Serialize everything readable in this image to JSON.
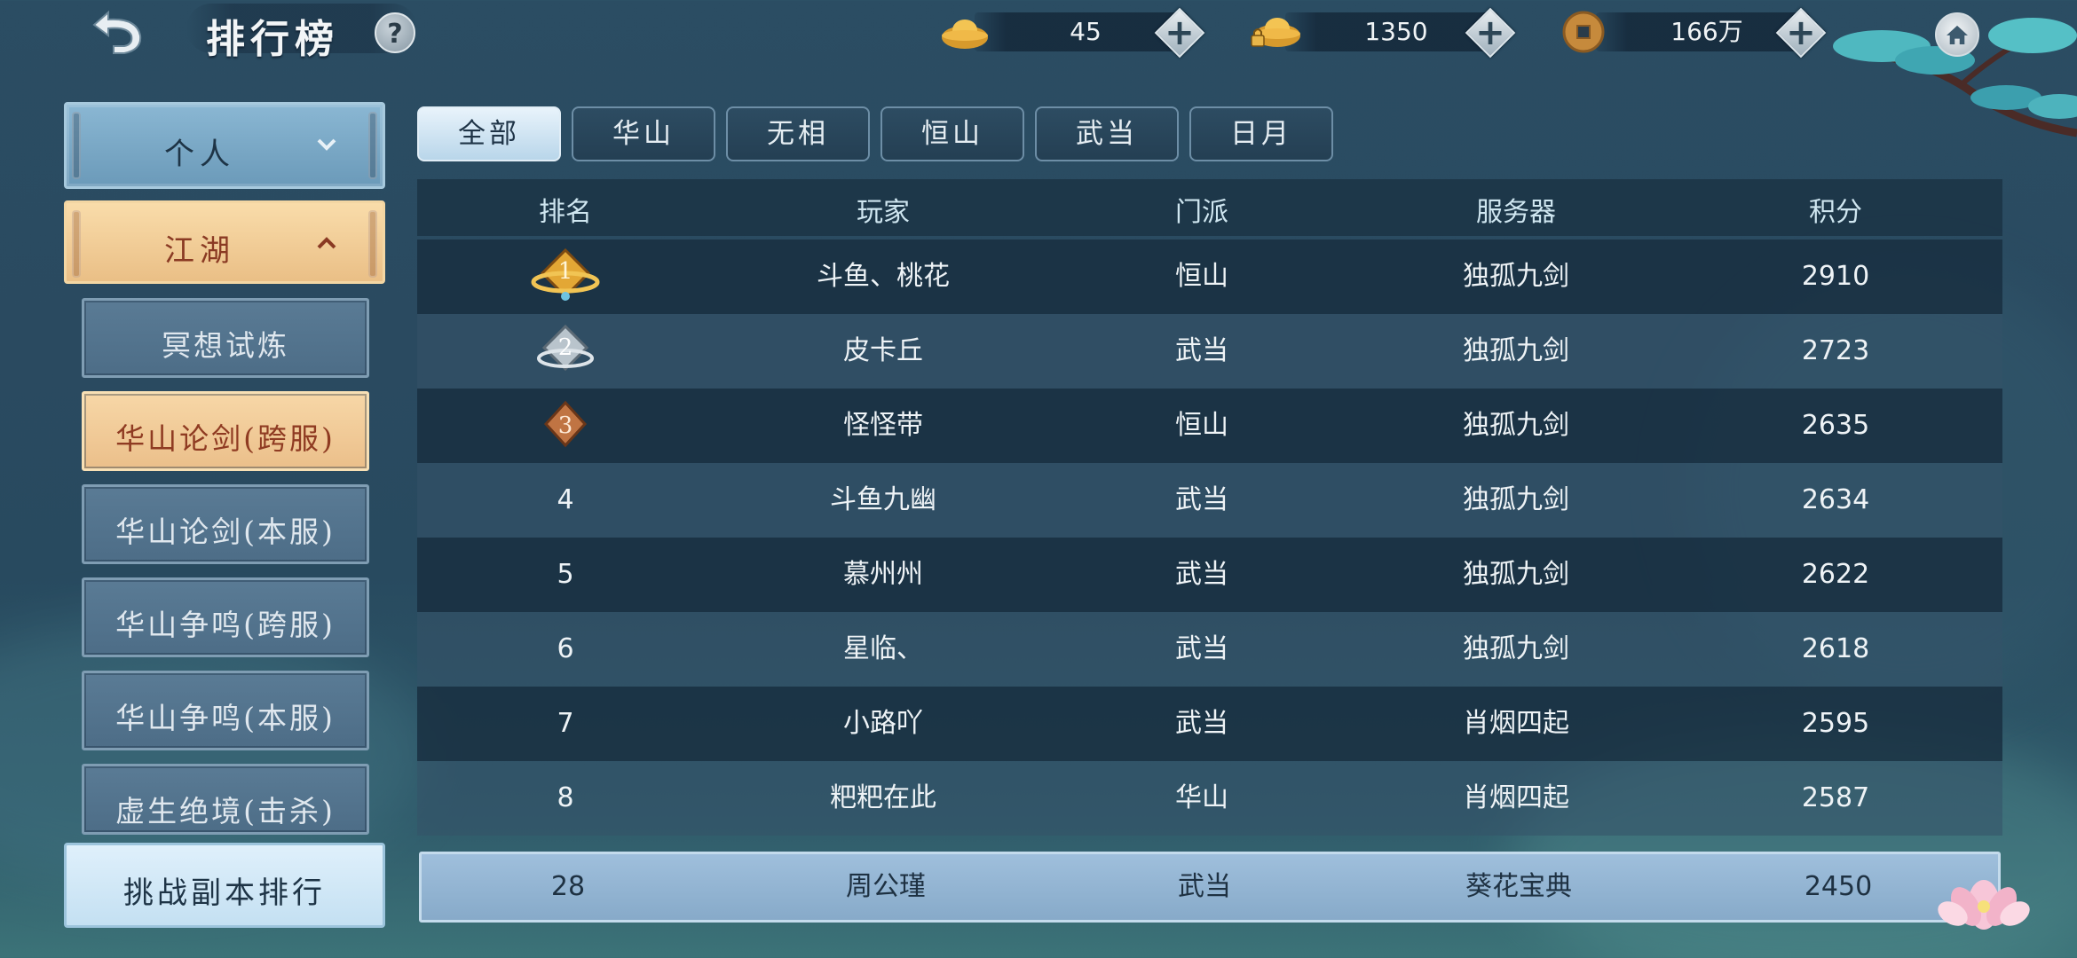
{
  "header": {
    "title": "排行榜",
    "help_label": "?",
    "currencies": [
      {
        "icon": "gold-ingot-icon",
        "value": "45"
      },
      {
        "icon": "locked-ingot-icon",
        "value": "1350"
      },
      {
        "icon": "copper-coin-icon",
        "value": "166万"
      }
    ],
    "plus_label": "+"
  },
  "sidebar": {
    "top_category": "个人",
    "active_category": "江湖",
    "items": [
      {
        "label": "冥想试炼",
        "active": false
      },
      {
        "label": "华山论剑(跨服)",
        "active": true
      },
      {
        "label": "华山论剑(本服)",
        "active": false
      },
      {
        "label": "华山争鸣(跨服)",
        "active": false
      },
      {
        "label": "华山争鸣(本服)",
        "active": false
      },
      {
        "label": "虚生绝境(击杀)",
        "active": false
      }
    ],
    "bottom_item": "挑战副本排行"
  },
  "tabs": [
    {
      "label": "全部",
      "active": true
    },
    {
      "label": "华山",
      "active": false
    },
    {
      "label": "无相",
      "active": false
    },
    {
      "label": "恒山",
      "active": false
    },
    {
      "label": "武当",
      "active": false
    },
    {
      "label": "日月",
      "active": false
    }
  ],
  "table": {
    "columns": [
      "排名",
      "玩家",
      "门派",
      "服务器",
      "积分"
    ],
    "rows": [
      {
        "rank": "1",
        "medal": "gold-medal-icon",
        "player": "斗鱼、桃花",
        "sect": "恒山",
        "server": "独孤九剑",
        "score": "2910"
      },
      {
        "rank": "2",
        "medal": "silver-medal-icon",
        "player": "皮卡丘",
        "sect": "武当",
        "server": "独孤九剑",
        "score": "2723"
      },
      {
        "rank": "3",
        "medal": "bronze-medal-icon",
        "player": "怪怪带",
        "sect": "恒山",
        "server": "独孤九剑",
        "score": "2635"
      },
      {
        "rank": "4",
        "player": "斗鱼九幽",
        "sect": "武当",
        "server": "独孤九剑",
        "score": "2634"
      },
      {
        "rank": "5",
        "player": "慕州州",
        "sect": "武当",
        "server": "独孤九剑",
        "score": "2622"
      },
      {
        "rank": "6",
        "player": "星临、",
        "sect": "武当",
        "server": "独孤九剑",
        "score": "2618"
      },
      {
        "rank": "7",
        "player": "小路吖",
        "sect": "武当",
        "server": "肖烟四起",
        "score": "2595"
      },
      {
        "rank": "8",
        "player": "粑粑在此",
        "sect": "华山",
        "server": "肖烟四起",
        "score": "2587"
      }
    ],
    "self": {
      "rank": "28",
      "player": "周公瑾",
      "sect": "武当",
      "server": "葵花宝典",
      "score": "2450"
    }
  },
  "colors": {
    "accent": "#ebbf86",
    "active_text": "#8a3a23",
    "tab_active": "#e8f3fb"
  }
}
